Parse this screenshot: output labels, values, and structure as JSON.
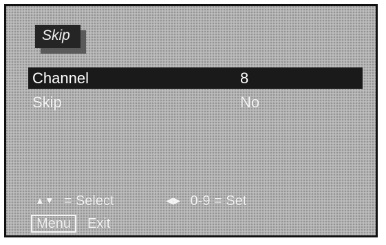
{
  "menu_title": "Skip",
  "rows": [
    {
      "label": "Channel",
      "value": "8",
      "selected": true
    },
    {
      "label": "Skip",
      "value": "No",
      "selected": false
    }
  ],
  "hints": {
    "select_arrows": "▲▼",
    "select_text": "= Select",
    "set_arrows": "◀▶",
    "set_text": "0-9 = Set",
    "menu_button": "Menu",
    "exit_text": "Exit"
  },
  "colors": {
    "background": "#b3b3b3",
    "highlight": "#1a1a1a",
    "text": "#f4f4f4"
  }
}
